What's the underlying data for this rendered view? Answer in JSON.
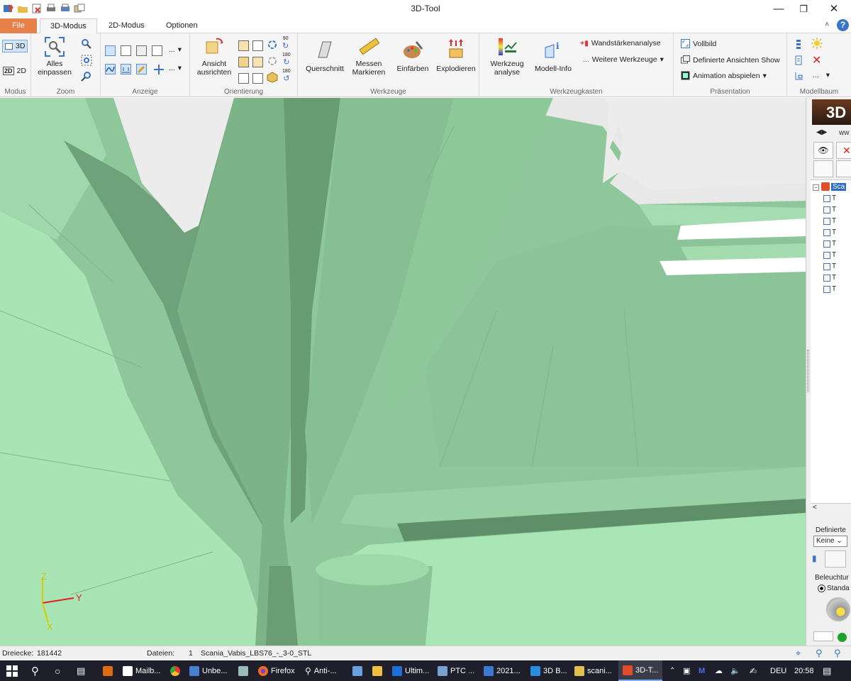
{
  "window": {
    "title": "3D-Tool"
  },
  "tabs": [
    {
      "label": "File"
    },
    {
      "label": "3D-Modus"
    },
    {
      "label": "2D-Modus"
    },
    {
      "label": "Optionen"
    }
  ],
  "ribbon": {
    "modus": {
      "label": "Modus",
      "btn3d": "3D",
      "btn2d": "2D"
    },
    "zoom": {
      "label": "Zoom",
      "fit_line1": "Alles",
      "fit_line2": "einpassen"
    },
    "anzeige": {
      "label": "Anzeige",
      "more": "..."
    },
    "orientierung": {
      "label": "Orientierung",
      "align_line1": "Ansicht",
      "align_line2": "ausrichten",
      "deg90": "90",
      "deg180a": "180",
      "deg180b": "180"
    },
    "werkzeuge": {
      "label": "Werkzeuge",
      "querschnitt": "Querschnitt",
      "messen_line1": "Messen",
      "messen_line2": "Markieren",
      "einfaerben": "Einfärben",
      "explodieren": "Explodieren"
    },
    "werkzeugkasten": {
      "label": "Werkzeugkasten",
      "wz_line1": "Werkzeug",
      "wz_line2": "analyse",
      "modell_info": "Modell-Info",
      "wandstaerke": "Wandstärkenanalyse",
      "weitere": "Weitere Werkzeuge"
    },
    "praesentation": {
      "label": "Präsentation",
      "vollbild": "Vollbild",
      "ansichten_show": "Definierte Ansichten Show",
      "animation": "Animation abspielen"
    },
    "modellbaum": {
      "label": "Modellbaum",
      "more": "..."
    }
  },
  "viewport": {
    "axis_x": "X",
    "axis_y": "Y",
    "axis_z": "Z"
  },
  "panel": {
    "logo": "3D",
    "url_fragment": "ww",
    "tree_root": "Sca",
    "tree_child": "T",
    "definierte": "Definierte",
    "keine": "Keine",
    "beleuchtung": "Beleuchtur",
    "standard": "Standa"
  },
  "status": {
    "dreiecke_label": "Dreiecke:",
    "dreiecke_value": "181442",
    "dateien_label": "Dateien:",
    "dateien_count": "1",
    "filename": "Scania_Vabis_LBS76_-_3-0_STL"
  },
  "taskbar": {
    "items": [
      "Mailb...",
      "Unbe...",
      "Firefox",
      "Anti-...",
      "Ultim...",
      "PTC ...",
      "2021...",
      "3D B...",
      "scani...",
      "3D-T..."
    ],
    "lang": "DEU",
    "time": "20:58"
  },
  "colors": {
    "accent_file": "#e8804a",
    "model_green": "#8fc89a",
    "taskbar": "#1f1f2b"
  }
}
